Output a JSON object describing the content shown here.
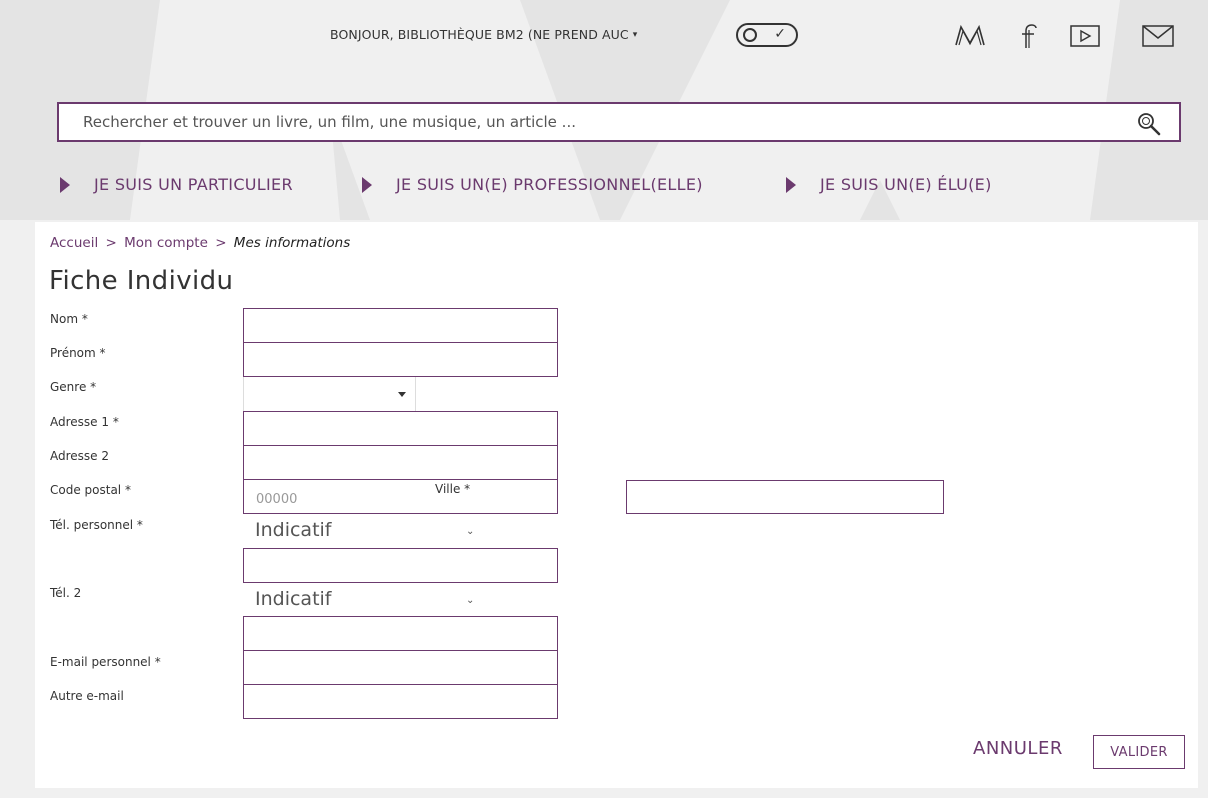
{
  "header": {
    "greeting": "BONJOUR, BIBLIOTHÈQUE BM2 (NE PREND AUC",
    "social": [
      {
        "icon": "medium-m-icon"
      },
      {
        "icon": "facebook-icon"
      },
      {
        "icon": "youtube-play-icon"
      },
      {
        "icon": "mail-icon"
      }
    ]
  },
  "search": {
    "placeholder": "Rechercher et trouver un livre, un film, une musique, un article ..."
  },
  "nav": {
    "items": [
      {
        "label": "JE SUIS UN PARTICULIER"
      },
      {
        "label": "JE SUIS UN(E) PROFESSIONNEL(ELLE)"
      },
      {
        "label": "JE SUIS UN(E) ÉLU(E)"
      }
    ]
  },
  "breadcrumb": {
    "home": "Accueil",
    "sep": ">",
    "account": "Mon compte",
    "current": "Mes informations"
  },
  "page_title": "Fiche Individu",
  "form": {
    "nom_label": "Nom *",
    "prenom_label": "Prénom *",
    "genre_label": "Genre *",
    "adresse1_label": "Adresse 1 *",
    "adresse2_label": "Adresse 2",
    "code_postal_label": "Code postal *",
    "code_postal_placeholder": "00000",
    "ville_label": "Ville *",
    "tel_perso_label": "Tél. personnel *",
    "tel2_label": "Tél. 2",
    "indicatif_label": "Indicatif",
    "email_perso_label": "E-mail personnel *",
    "autre_email_label": "Autre e-mail"
  },
  "actions": {
    "cancel": "ANNULER",
    "validate": "VALIDER"
  },
  "colors": {
    "accent": "#6b3a6e",
    "background": "#f0f0f0",
    "card": "#ffffff"
  }
}
